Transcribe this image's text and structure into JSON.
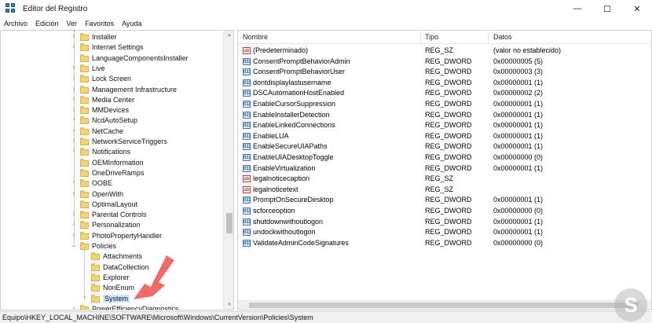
{
  "window": {
    "title": "Editor del Registro",
    "minimize": "—",
    "maximize": "☐",
    "close": "✕"
  },
  "menu": [
    "Archivo",
    "Edición",
    "Ver",
    "Favoritos",
    "Ayuda"
  ],
  "tree": {
    "items": [
      {
        "label": "Installer",
        "expander": "›"
      },
      {
        "label": "Internet Settings",
        "expander": "›"
      },
      {
        "label": "LanguageComponentsInstaller",
        "expander": ""
      },
      {
        "label": "Live",
        "expander": "›"
      },
      {
        "label": "Lock Screen",
        "expander": "›"
      },
      {
        "label": "Management Infrastructure",
        "expander": "›"
      },
      {
        "label": "Media Center",
        "expander": "›"
      },
      {
        "label": "MMDevices",
        "expander": "›"
      },
      {
        "label": "NcdAutoSetup",
        "expander": "›"
      },
      {
        "label": "NetCache",
        "expander": "›"
      },
      {
        "label": "NetworkServiceTriggers",
        "expander": "›"
      },
      {
        "label": "Notifications",
        "expander": "›"
      },
      {
        "label": "OEMInformation",
        "expander": ""
      },
      {
        "label": "OneDriveRamps",
        "expander": ""
      },
      {
        "label": "OOBE",
        "expander": "›"
      },
      {
        "label": "OpenWith",
        "expander": "›"
      },
      {
        "label": "OptimalLayout",
        "expander": ""
      },
      {
        "label": "Parental Controls",
        "expander": "›"
      },
      {
        "label": "Personalization",
        "expander": "›"
      },
      {
        "label": "PhotoPropertyHandler",
        "expander": "›"
      },
      {
        "label": "Policies",
        "expander": "⌄"
      },
      {
        "label": "Attachments",
        "expander": ""
      },
      {
        "label": "DataCollection",
        "expander": ""
      },
      {
        "label": "Explorer",
        "expander": ""
      },
      {
        "label": "NonEnum",
        "expander": ""
      },
      {
        "label": "System",
        "expander": "›"
      },
      {
        "label": "PowerEfficiencyDiagnostics",
        "expander": "›"
      }
    ],
    "selected": "System"
  },
  "list": {
    "columns": {
      "name": "Nombre",
      "type": "Tipo",
      "data": "Datos"
    },
    "rows": [
      {
        "name": "(Predeterminado)",
        "type": "REG_SZ",
        "data": "(valor no establecido)",
        "icon": "ab"
      },
      {
        "name": "ConsentPromptBehaviorAdmin",
        "type": "REG_DWORD",
        "data": "0x00000005 (5)",
        "icon": "011"
      },
      {
        "name": "ConsentPromptBehaviorUser",
        "type": "REG_DWORD",
        "data": "0x00000003 (3)",
        "icon": "011"
      },
      {
        "name": "dontdisplaylastusername",
        "type": "REG_DWORD",
        "data": "0x00000001 (1)",
        "icon": "011"
      },
      {
        "name": "DSCAutomationHostEnabled",
        "type": "REG_DWORD",
        "data": "0x00000002 (2)",
        "icon": "011"
      },
      {
        "name": "EnableCursorSuppression",
        "type": "REG_DWORD",
        "data": "0x00000001 (1)",
        "icon": "011"
      },
      {
        "name": "EnableInstallerDetection",
        "type": "REG_DWORD",
        "data": "0x00000001 (1)",
        "icon": "011"
      },
      {
        "name": "EnableLinkedConnections",
        "type": "REG_DWORD",
        "data": "0x00000001 (1)",
        "icon": "011"
      },
      {
        "name": "EnableLUA",
        "type": "REG_DWORD",
        "data": "0x00000001 (1)",
        "icon": "011"
      },
      {
        "name": "EnableSecureUIAPaths",
        "type": "REG_DWORD",
        "data": "0x00000001 (1)",
        "icon": "011"
      },
      {
        "name": "EnableUIADesktopToggle",
        "type": "REG_DWORD",
        "data": "0x00000000 (0)",
        "icon": "011"
      },
      {
        "name": "EnableVirtualization",
        "type": "REG_DWORD",
        "data": "0x00000001 (1)",
        "icon": "011"
      },
      {
        "name": "legalnoticecaption",
        "type": "REG_SZ",
        "data": "",
        "icon": "ab"
      },
      {
        "name": "legalnoticetext",
        "type": "REG_SZ",
        "data": "",
        "icon": "ab"
      },
      {
        "name": "PromptOnSecureDesktop",
        "type": "REG_DWORD",
        "data": "0x00000001 (1)",
        "icon": "011"
      },
      {
        "name": "scforceoption",
        "type": "REG_DWORD",
        "data": "0x00000000 (0)",
        "icon": "011"
      },
      {
        "name": "shutdownwithoutlogon",
        "type": "REG_DWORD",
        "data": "0x00000001 (1)",
        "icon": "011"
      },
      {
        "name": "undockwithoutlogon",
        "type": "REG_DWORD",
        "data": "0x00000001 (1)",
        "icon": "011"
      },
      {
        "name": "ValidateAdminCodeSignatures",
        "type": "REG_DWORD",
        "data": "0x00000000 (0)",
        "icon": "011"
      }
    ]
  },
  "status": "Equipo\\HKEY_LOCAL_MACHINE\\SOFTWARE\\Microsoft\\Windows\\CurrentVersion\\Policies\\System",
  "colors": {
    "selection": "#cce8ff",
    "arrow": "#f06a6a",
    "folder": "#f2d27a"
  },
  "icons": {
    "app": "registry-icon",
    "folder": "folder-icon",
    "string_value": "reg-sz-icon",
    "dword_value": "reg-dword-icon"
  }
}
